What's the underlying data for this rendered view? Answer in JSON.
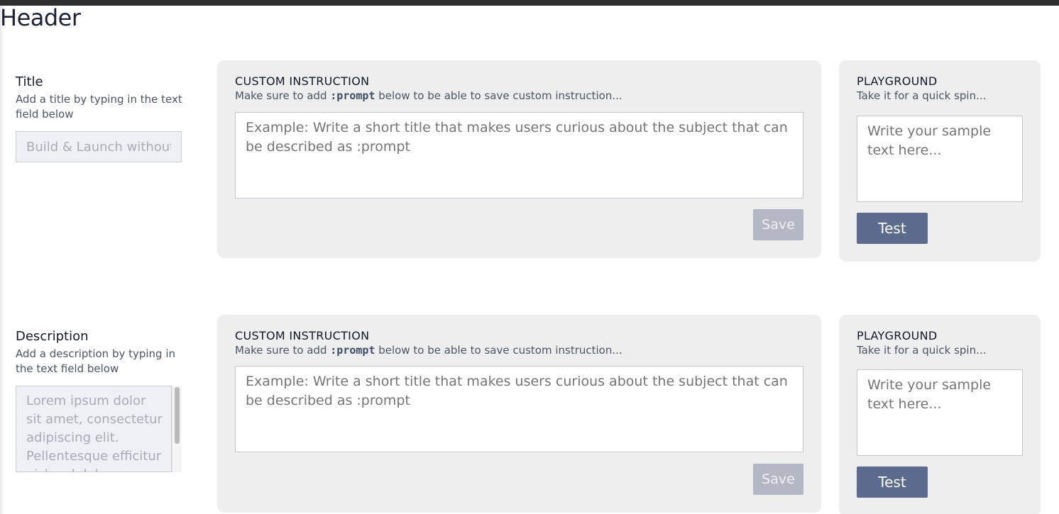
{
  "page": {
    "title": "Header"
  },
  "sections": [
    {
      "field": {
        "label": "Title",
        "help": "Add a title by typing in the text field below",
        "value": "Build & Launch without"
      },
      "custom": {
        "heading": "CUSTOM INSTRUCTION",
        "sub_prefix": "Make sure to add ",
        "sub_code": ":prompt",
        "sub_suffix": " below to be able to save custom instruction...",
        "placeholder": "Example: Write a short title that makes users curious about the subject that can be described as :prompt",
        "save_label": "Save"
      },
      "playground": {
        "heading": "PLAYGROUND",
        "sub": "Take it for a quick spin...",
        "placeholder": "Write your sample text here...",
        "test_label": "Test"
      }
    },
    {
      "field": {
        "label": "Description",
        "help": "Add a description by typing in the text field below",
        "value": "Lorem ipsum dolor sit amet, consectetur adipiscing elit. Pellentesque efficitur nisl sed dolor"
      },
      "custom": {
        "heading": "CUSTOM INSTRUCTION",
        "sub_prefix": "Make sure to add ",
        "sub_code": ":prompt",
        "sub_suffix": " below to be able to save custom instruction...",
        "placeholder": "Example: Write a short title that makes users curious about the subject that can be described as :prompt",
        "save_label": "Save"
      },
      "playground": {
        "heading": "PLAYGROUND",
        "sub": "Take it for a quick spin...",
        "placeholder": "Write your sample text here...",
        "test_label": "Test"
      }
    }
  ]
}
